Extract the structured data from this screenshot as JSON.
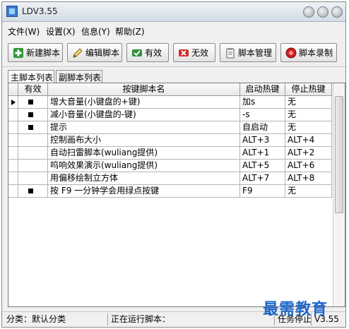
{
  "window": {
    "title": "LDV3.55"
  },
  "menu": [
    "文件(W)",
    "设置(X)",
    "信息(Y)",
    "帮助(Z)"
  ],
  "toolbar": {
    "new": "新建脚本",
    "edit": "编辑脚本",
    "enable": "有效",
    "disable": "无效",
    "manage": "脚本管理",
    "record": "脚本录制"
  },
  "tabs": [
    "主脚本列表",
    "副脚本列表"
  ],
  "table": {
    "headers": [
      "有效",
      "按键脚本名",
      "启动热键",
      "停止热键"
    ],
    "rows": [
      {
        "enabled": true,
        "name": "增大音量(小键盘的+键)",
        "start": "加s",
        "stop": "无",
        "current": true
      },
      {
        "enabled": true,
        "name": "减小音量(小键盘的-键)",
        "start": "-s",
        "stop": "无",
        "current": false
      },
      {
        "enabled": true,
        "name": "提示",
        "start": "自启动",
        "stop": "无",
        "current": false
      },
      {
        "enabled": false,
        "name": "控制画布大小",
        "start": "ALT+3",
        "stop": "ALT+4",
        "current": false
      },
      {
        "enabled": false,
        "name": "自动扫雷脚本(wuliang提供)",
        "start": "ALT+1",
        "stop": "ALT+2",
        "current": false
      },
      {
        "enabled": false,
        "name": "呜响效果演示(wuliang提供)",
        "start": "ALT+5",
        "stop": "ALT+6",
        "current": false
      },
      {
        "enabled": false,
        "name": "用偏移绘制立方体",
        "start": "ALT+7",
        "stop": "ALT+8",
        "current": false
      },
      {
        "enabled": true,
        "name": "按 F9 一分钟学会用绿点按键",
        "start": "F9",
        "stop": "无",
        "current": false
      }
    ]
  },
  "status": {
    "category": "分类：默认分类",
    "running": "正在运行脚本：",
    "task": "任务停止",
    "version": "V3.55"
  },
  "watermark": "最需教育",
  "colors": {
    "accent": "#1f66c8"
  }
}
